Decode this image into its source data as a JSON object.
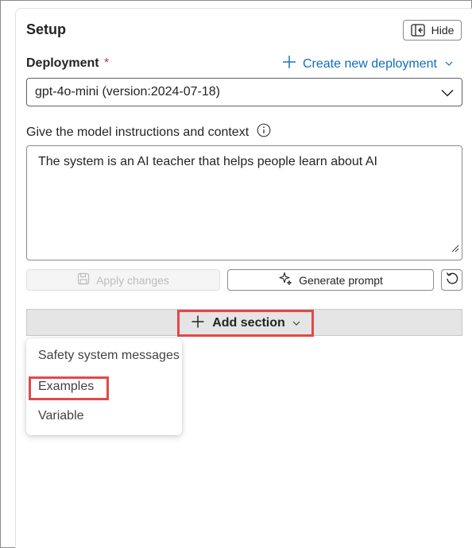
{
  "panel": {
    "title": "Setup",
    "hide_label": "Hide"
  },
  "deployment": {
    "label": "Deployment",
    "required_marker": "*",
    "create_link": "Create new deployment",
    "selected": "gpt-4o-mini (version:2024-07-18)"
  },
  "instructions": {
    "label": "Give the model instructions and context",
    "text": "The system is an AI teacher that helps people learn about AI"
  },
  "actions": {
    "apply_label": "Apply changes",
    "generate_label": "Generate prompt"
  },
  "add_section": {
    "label": "Add section",
    "menu_items": [
      "Safety system messages",
      "Examples",
      "Variable"
    ],
    "highlighted_item": "Examples"
  },
  "colors": {
    "accent": "#0f6cbd",
    "highlight_box": "#e04a4a",
    "required": "#c4314b"
  },
  "icons": [
    "hide-panel-icon",
    "plus-icon",
    "chevron-down-icon",
    "info-icon",
    "save-icon",
    "sparkle-icon",
    "reset-icon",
    "resize-grip-icon"
  ]
}
